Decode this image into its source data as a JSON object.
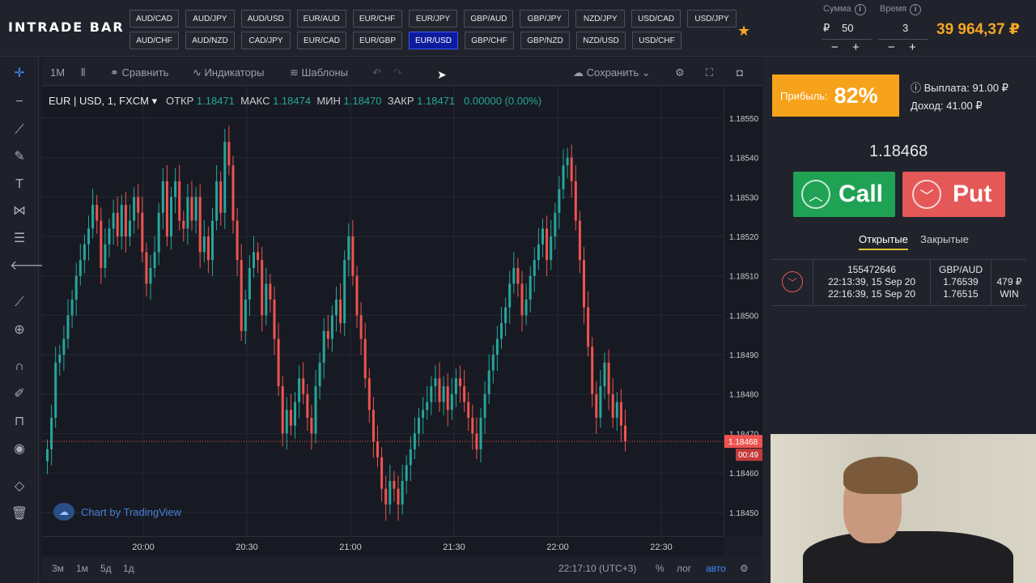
{
  "app": {
    "logo": "INTRADE BAR"
  },
  "pairs": {
    "row1": [
      "AUD/CAD",
      "AUD/JPY",
      "AUD/USD",
      "EUR/AUD",
      "EUR/CHF",
      "EUR/JPY",
      "GBP/AUD",
      "GBP/JPY",
      "NZD/JPY",
      "USD/CAD",
      "USD/JPY"
    ],
    "row2": [
      "AUD/CHF",
      "AUD/NZD",
      "CAD/JPY",
      "EUR/CAD",
      "EUR/GBP",
      "EUR/USD",
      "GBP/CHF",
      "GBP/NZD",
      "NZD/USD",
      "USD/CHF"
    ],
    "active": "EUR/USD"
  },
  "trade_params": {
    "amount_label": "Сумма",
    "time_label": "Время",
    "info": "i",
    "currency": "₽",
    "amount": "50",
    "time": "3",
    "minus": "−",
    "plus": "+"
  },
  "balance": "39 964,37 ₽",
  "chart_toolbar": {
    "interval": "1M",
    "compare": "Сравнить",
    "indicators": "Индикаторы",
    "templates": "Шаблоны",
    "save": "Сохранить"
  },
  "legend": {
    "symbol": "EUR | USD, 1, FXCM ▾",
    "open_label": "ОТКР",
    "open": "1.18471",
    "high_label": "МАКС",
    "high": "1.18474",
    "low_label": "МИН",
    "low": "1.18470",
    "close_label": "ЗАКР",
    "close": "1.18471",
    "change": "0.00000 (0.00%)"
  },
  "watermark": "Chart by TradingView",
  "bottom_bar": {
    "ranges": [
      "3м",
      "1м",
      "5д",
      "1д"
    ],
    "clock": "22:17:10 (UTC+3)",
    "percent": "%",
    "log": "лог",
    "auto": "авто"
  },
  "colors": {
    "up": "#26a69a",
    "down": "#ef5350",
    "accent": "#f5a623",
    "grid": "#252935"
  },
  "chart_data": {
    "type": "candlestick",
    "x_ticks": [
      "20:00",
      "20:30",
      "21:00",
      "21:30",
      "22:00",
      "22:30"
    ],
    "y_ticks": [
      1.1855,
      1.1854,
      1.1853,
      1.1852,
      1.1851,
      1.185,
      1.1849,
      1.1848,
      1.1847,
      1.1846,
      1.1845
    ],
    "y_tick_labels": [
      "1.18550",
      "1.18540",
      "1.18530",
      "1.18520",
      "1.18510",
      "1.18500",
      "1.18490",
      "1.18480",
      "1.18470",
      "1.18460",
      "1.18450"
    ],
    "ylim": [
      1.18444,
      1.18558
    ],
    "last_price": 1.18468,
    "last_price_label": "1.18468",
    "countdown": "00:49",
    "close_series": [
      1.18466,
      1.18474,
      1.18488,
      1.1849,
      1.18494,
      1.185,
      1.18504,
      1.1851,
      1.18514,
      1.18518,
      1.18522,
      1.18528,
      1.18524,
      1.18512,
      1.18518,
      1.18522,
      1.18526,
      1.1852,
      1.18528,
      1.1852,
      1.18524,
      1.1853,
      1.18526,
      1.18516,
      1.18508,
      1.18512,
      1.18516,
      1.18526,
      1.18534,
      1.1852,
      1.1853,
      1.18534,
      1.18524,
      1.18522,
      1.1853,
      1.18524,
      1.1853,
      1.18516,
      1.1852,
      1.18514,
      1.18524,
      1.18534,
      1.18526,
      1.18544,
      1.18538,
      1.18524,
      1.18514,
      1.18496,
      1.18504,
      1.18512,
      1.18516,
      1.18514,
      1.185,
      1.18508,
      1.18504,
      1.18494,
      1.18482,
      1.1847,
      1.18476,
      1.18472,
      1.18478,
      1.18484,
      1.1848,
      1.18474,
      1.1847,
      1.18482,
      1.18488,
      1.18496,
      1.18494,
      1.185,
      1.18504,
      1.18498,
      1.18514,
      1.1852,
      1.1851,
      1.185,
      1.18494,
      1.18484,
      1.18476,
      1.18468,
      1.18464,
      1.18456,
      1.18452,
      1.18458,
      1.18456,
      1.18452,
      1.18458,
      1.18462,
      1.18466,
      1.1847,
      1.18474,
      1.18476,
      1.18478,
      1.18482,
      1.18484,
      1.18478,
      1.18482,
      1.18476,
      1.1848,
      1.18484,
      1.18482,
      1.18478,
      1.18474,
      1.1847,
      1.18466,
      1.18474,
      1.1848,
      1.18486,
      1.1849,
      1.18494,
      1.18498,
      1.18502,
      1.18508,
      1.18512,
      1.18508,
      1.185,
      1.18504,
      1.1851,
      1.18514,
      1.18518,
      1.18522,
      1.18514,
      1.1852,
      1.18526,
      1.18532,
      1.18538,
      1.1854,
      1.18534,
      1.18524,
      1.18514,
      1.18502,
      1.18492,
      1.1848,
      1.18474,
      1.18482,
      1.18488,
      1.1848,
      1.18474,
      1.18478,
      1.18472,
      1.18468
    ]
  },
  "right_panel": {
    "profit_label": "Прибыль:",
    "profit_value": "82%",
    "payout": "ⓘ Выплата: 91.00 ₽",
    "income": "Доход: 41.00 ₽",
    "current_price": "1.18468",
    "call": "Call",
    "put": "Put",
    "tab_open": "Открытые",
    "tab_closed": "Закрытые",
    "trade": {
      "id": "155472646",
      "open_time": "22:13:39, 15 Sep 20",
      "close_time": "22:16:39, 15 Sep 20",
      "pair": "GBP/AUD",
      "open_price": "1.76539",
      "close_price": "1.76515",
      "amount": "479 ₽",
      "result": "WIN"
    }
  }
}
